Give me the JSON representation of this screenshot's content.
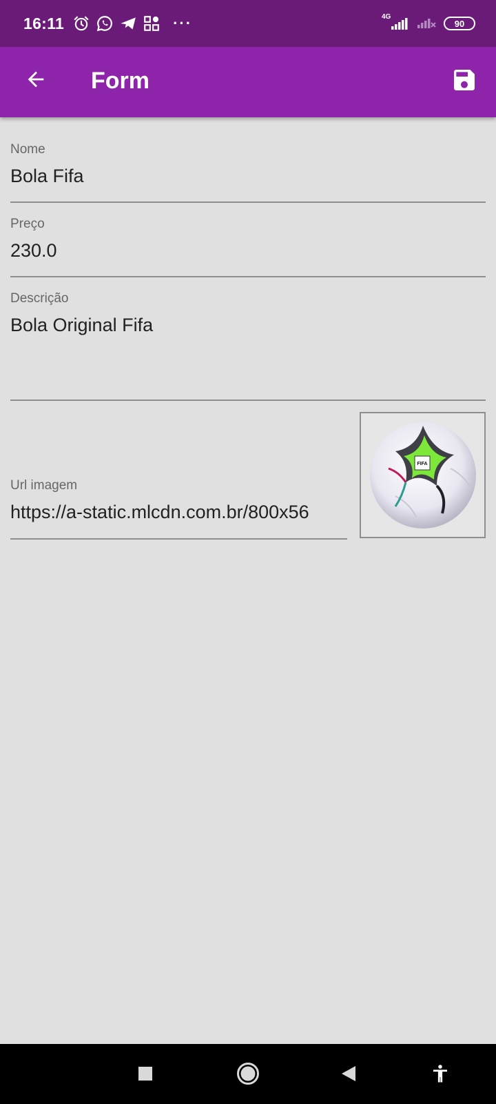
{
  "status_bar": {
    "time": "16:11",
    "network_label": "4G",
    "battery": "90",
    "more_indicator": "···",
    "icons": [
      "alarm-icon",
      "whatsapp-icon",
      "paper-plane-icon",
      "apps-grid-icon",
      "signal-icon",
      "signal-weak-icon",
      "battery-icon"
    ]
  },
  "app_bar": {
    "title": "Form",
    "background": "#8e24aa",
    "back_icon": "arrow-back-icon",
    "save_icon": "save-floppy-icon"
  },
  "form": {
    "nome": {
      "label": "Nome",
      "value": "Bola Fifa"
    },
    "preco": {
      "label": "Preço",
      "value": "230.0"
    },
    "descricao": {
      "label": "Descrição",
      "value": "Bola Original Fifa"
    },
    "url_imagem": {
      "label": "Url imagem",
      "value": "https://a-static.mlcdn.com.br/800x56"
    },
    "image_badge": "FIFA"
  },
  "colors": {
    "status_bar": "#6a1b78",
    "app_bar": "#8e24aa",
    "background": "#e0e0e0",
    "underline": "#8e8e8e"
  },
  "nav_bar": {
    "icons": [
      "recents-square-icon",
      "home-circle-icon",
      "back-triangle-icon",
      "accessibility-icon"
    ]
  }
}
